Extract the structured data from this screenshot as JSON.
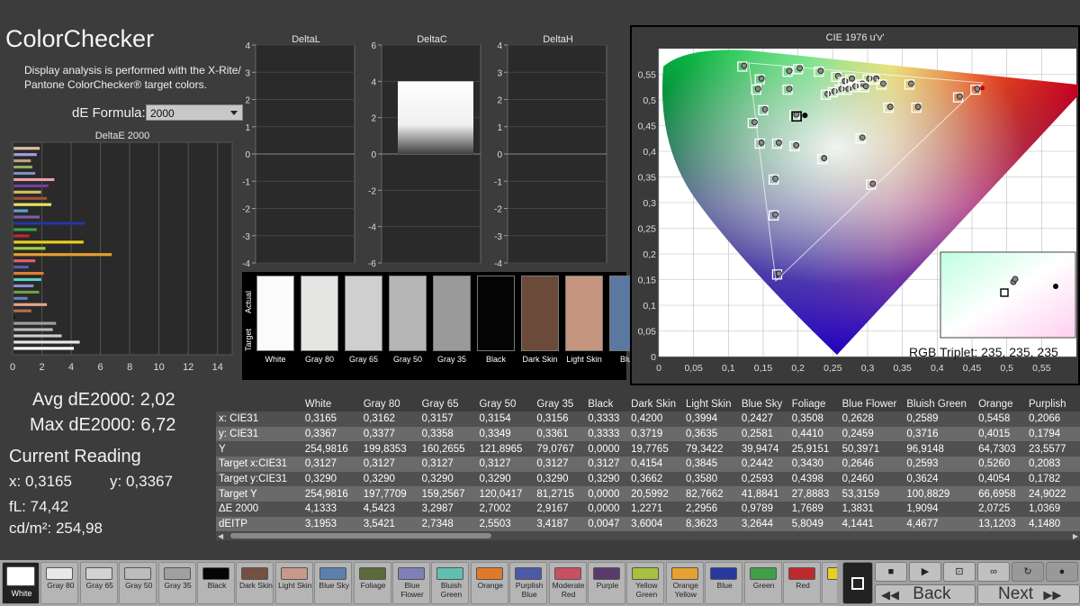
{
  "header": {
    "title": "ColorChecker",
    "description": "Display analysis is performed with the X-Rite/ Pantone ColorChecker® target colors.",
    "formula_label": "dE Formula:",
    "formula_value": "2000"
  },
  "deltaE_chart": {
    "title": "DeltaE 2000",
    "x_ticks": [
      "0",
      "2",
      "4",
      "6",
      "8",
      "10",
      "12",
      "14"
    ]
  },
  "delta_charts": [
    {
      "title": "DeltaL",
      "ticks": [
        "4",
        "3",
        "2",
        "1",
        "0",
        "-1",
        "-2",
        "-3",
        "-4"
      ]
    },
    {
      "title": "DeltaC",
      "ticks": [
        "6",
        "4",
        "2",
        "0",
        "-2",
        "-4",
        "-6"
      ]
    },
    {
      "title": "DeltaH",
      "ticks": [
        "4",
        "3",
        "2",
        "1",
        "0",
        "-1",
        "-2",
        "-3",
        "-4"
      ]
    }
  ],
  "stats": {
    "avg": "Avg dE2000: 2,02",
    "max": "Max dE2000: 6,72",
    "current_reading": "Current Reading",
    "x": "x: 0,3165",
    "y": "y: 0,3367",
    "fL": "fL: 74,42",
    "cdm2": "cd/m²: 254,98"
  },
  "swatch_strip": {
    "actual_label": "Actual",
    "target_label": "Target",
    "items": [
      {
        "name": "White",
        "color": "#fbfbfb"
      },
      {
        "name": "Gray 80",
        "color": "#e4e4e2"
      },
      {
        "name": "Gray 65",
        "color": "#cfcfcf"
      },
      {
        "name": "Gray 50",
        "color": "#b6b6b6"
      },
      {
        "name": "Gray 35",
        "color": "#9a9a9a"
      },
      {
        "name": "Black",
        "color": "#050505"
      },
      {
        "name": "Dark Skin",
        "color": "#6b4a3a"
      },
      {
        "name": "Light Skin",
        "color": "#c6957f"
      },
      {
        "name": "Blue",
        "color": "#5a78a0"
      }
    ]
  },
  "cie": {
    "title": "CIE 1976 u'v'",
    "y_ticks": [
      "0,55",
      "0,5",
      "0,45",
      "0,4",
      "0,35",
      "0,3",
      "0,25",
      "0,2",
      "0,15",
      "0,1",
      "0,05",
      "0"
    ],
    "x_ticks": [
      "0",
      "0,05",
      "0,1",
      "0,15",
      "0,2",
      "0,25",
      "0,3",
      "0,35",
      "0,4",
      "0,45",
      "0,5",
      "0,55"
    ],
    "rgb_triplet": "RGB Triplet: 235, 235, 235"
  },
  "table": {
    "columns": [
      "",
      "White",
      "Gray 80",
      "Gray 65",
      "Gray 50",
      "Gray 35",
      "Black",
      "Dark Skin",
      "Light Skin",
      "Blue Sky",
      "Foliage",
      "Blue Flower",
      "Bluish Green",
      "Orange",
      "Purplish"
    ],
    "rows": [
      [
        "x: CIE31",
        "0,3165",
        "0,3162",
        "0,3157",
        "0,3154",
        "0,3156",
        "0,3333",
        "0,4200",
        "0,3994",
        "0,2427",
        "0,3508",
        "0,2628",
        "0,2589",
        "0,5458",
        "0,2066"
      ],
      [
        "y: CIE31",
        "0,3367",
        "0,3377",
        "0,3358",
        "0,3349",
        "0,3361",
        "0,3333",
        "0,3719",
        "0,3635",
        "0,2581",
        "0,4410",
        "0,2459",
        "0,3716",
        "0,4015",
        "0,1794"
      ],
      [
        "Y",
        "254,9816",
        "199,8353",
        "160,2655",
        "121,8965",
        "79,0767",
        "0,0000",
        "19,7765",
        "79,3422",
        "39,9474",
        "25,9151",
        "50,3971",
        "96,9148",
        "64,7303",
        "23,5577"
      ],
      [
        "Target x:CIE31",
        "0,3127",
        "0,3127",
        "0,3127",
        "0,3127",
        "0,3127",
        "0,3127",
        "0,4154",
        "0,3845",
        "0,2442",
        "0,3430",
        "0,2646",
        "0,2593",
        "0,5260",
        "0,2083"
      ],
      [
        "Target y:CIE31",
        "0,3290",
        "0,3290",
        "0,3290",
        "0,3290",
        "0,3290",
        "0,3290",
        "0,3662",
        "0,3580",
        "0,2593",
        "0,4398",
        "0,2460",
        "0,3624",
        "0,4054",
        "0,1782"
      ],
      [
        "Target Y",
        "254,9816",
        "197,7709",
        "159,2567",
        "120,0417",
        "81,2715",
        "0,0000",
        "20,5992",
        "82,7662",
        "41,8841",
        "27,8883",
        "53,3159",
        "100,8829",
        "66,6958",
        "24,9022"
      ],
      [
        "ΔE 2000",
        "4,1333",
        "4,5423",
        "3,2987",
        "2,7002",
        "2,9167",
        "0,0000",
        "1,2271",
        "2,2956",
        "0,9789",
        "1,7689",
        "1,3831",
        "1,9094",
        "2,0725",
        "1,0369"
      ],
      [
        "dEITP",
        "3,1953",
        "3,5421",
        "2,7348",
        "2,5503",
        "3,4187",
        "0,0047",
        "3,6004",
        "8,3623",
        "3,2644",
        "5,8049",
        "4,1441",
        "4,4677",
        "13,1203",
        "4,1480"
      ]
    ]
  },
  "bottom_swatches": [
    {
      "label": "White",
      "color": "#ffffff",
      "active": true
    },
    {
      "label": "Gray 80",
      "color": "#e8e8e8"
    },
    {
      "label": "Gray 65",
      "color": "#d2d2d2"
    },
    {
      "label": "Gray 50",
      "color": "#bcbcbc"
    },
    {
      "label": "Gray 35",
      "color": "#a0a0a0"
    },
    {
      "label": "Black",
      "color": "#050505"
    },
    {
      "label": "Dark Skin",
      "color": "#73503f"
    },
    {
      "label": "Light Skin",
      "color": "#c8988a"
    },
    {
      "label": "Blue Sky",
      "color": "#5d7fb0"
    },
    {
      "label": "Foliage",
      "color": "#5a6a3a"
    },
    {
      "label": "Blue Flower",
      "color": "#8080b8"
    },
    {
      "label": "Bluish Green",
      "color": "#60c0b0"
    },
    {
      "label": "Orange",
      "color": "#e07a28"
    },
    {
      "label": "Purplish Blue",
      "color": "#4c5aa8"
    },
    {
      "label": "Moderate Red",
      "color": "#c85060"
    },
    {
      "label": "Purple",
      "color": "#5a3a6a"
    },
    {
      "label": "Yellow Green",
      "color": "#a8c040"
    },
    {
      "label": "Orange Yellow",
      "color": "#e8a030"
    },
    {
      "label": "Blue",
      "color": "#2838a0"
    },
    {
      "label": "Green",
      "color": "#40a048"
    },
    {
      "label": "Red",
      "color": "#c02830"
    },
    {
      "label": "Yel",
      "color": "#e8d020"
    }
  ],
  "controls": {
    "back": "Back",
    "next": "Next"
  }
}
